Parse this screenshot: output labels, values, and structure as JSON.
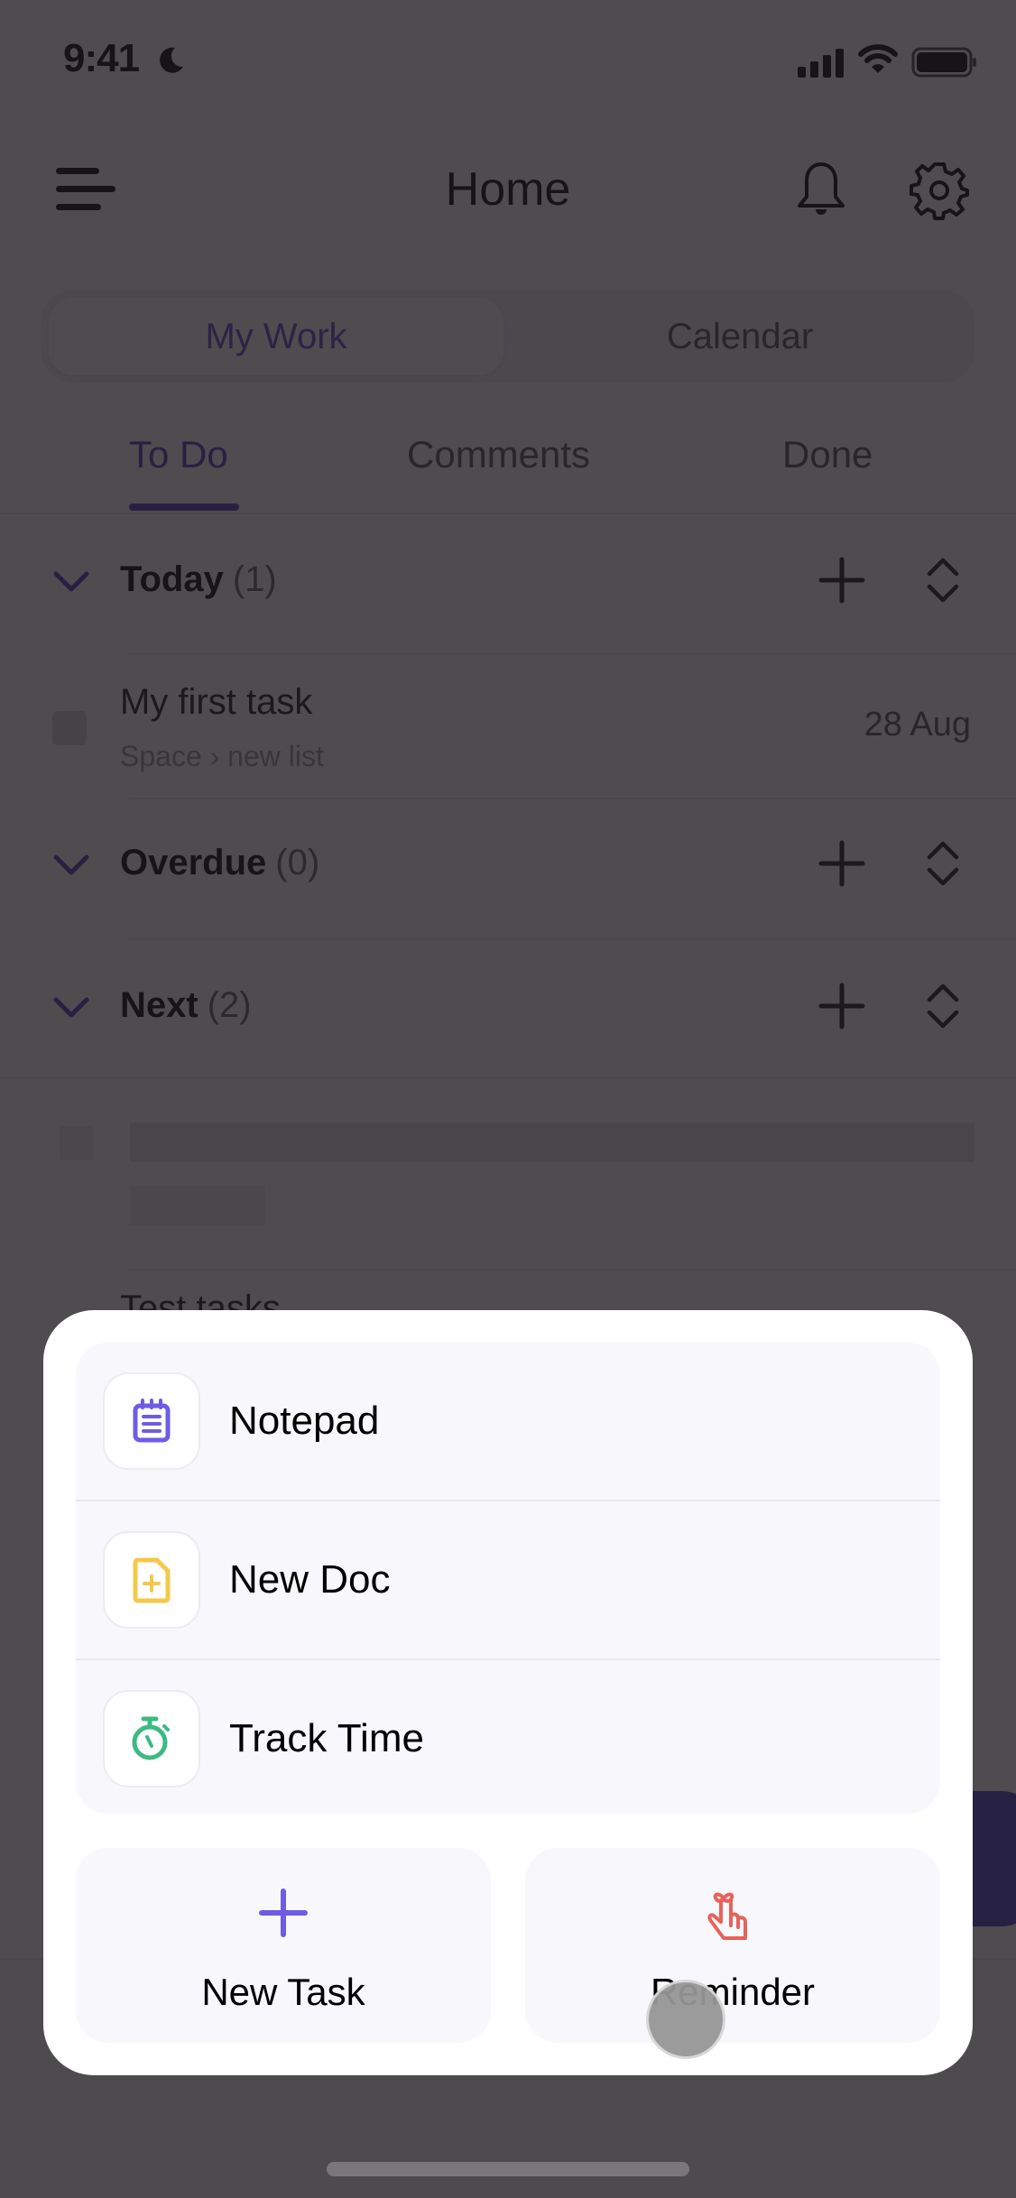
{
  "status_bar": {
    "time": "9:41",
    "focus_icon": "moon-icon",
    "signal_icon": "cellular-signal-icon",
    "wifi_icon": "wifi-icon",
    "battery_icon": "battery-icon"
  },
  "header": {
    "title": "Home",
    "menu_icon": "hamburger-menu-icon",
    "notifications_icon": "bell-icon",
    "settings_icon": "gear-icon"
  },
  "segmented": {
    "options": [
      {
        "label": "My Work",
        "selected": true
      },
      {
        "label": "Calendar",
        "selected": false
      }
    ]
  },
  "tabs": [
    {
      "label": "To Do",
      "active": true
    },
    {
      "label": "Comments",
      "active": false
    },
    {
      "label": "Done",
      "active": false
    }
  ],
  "sections": [
    {
      "title": "Today",
      "count": "(1)"
    },
    {
      "title": "Overdue",
      "count": "(0)"
    },
    {
      "title": "Next",
      "count": "(2)"
    }
  ],
  "tasks": {
    "today": [
      {
        "name": "My first task",
        "path_space": "Space",
        "path_list": "new list",
        "date": "28 Aug"
      }
    ],
    "next_partial_name": "Test tasks"
  },
  "action_sheet": {
    "menu_items": [
      {
        "label": "Notepad",
        "icon": "notepad-icon"
      },
      {
        "label": "New Doc",
        "icon": "new-doc-icon"
      },
      {
        "label": "Track Time",
        "icon": "stopwatch-icon"
      }
    ],
    "tiles": [
      {
        "label": "New Task",
        "icon": "plus-icon"
      },
      {
        "label": "Reminder",
        "icon": "reminder-finger-icon"
      }
    ]
  },
  "colors": {
    "accent": "#4b3bc9",
    "notepad_icon": "#6e5ce6",
    "doc_icon": "#f4c84a",
    "timer_icon": "#3dba82",
    "reminder_icon": "#e8625a",
    "overlay": "#4e4c50"
  }
}
